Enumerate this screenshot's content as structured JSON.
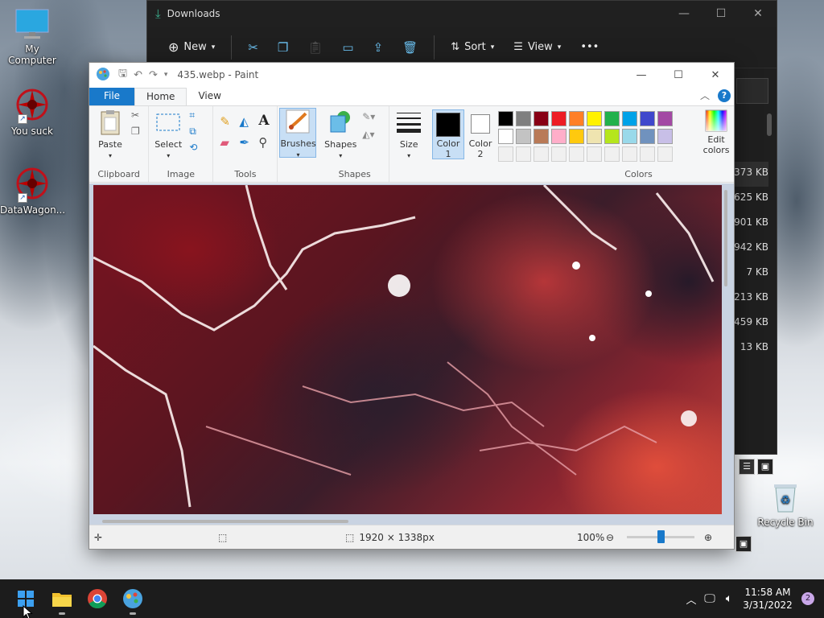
{
  "desktop": {
    "icons": [
      {
        "label": "My Computer",
        "icon": "monitor-icon"
      },
      {
        "label": "You suck",
        "icon": "red-ornament-icon"
      },
      {
        "label": "DataWagon...",
        "icon": "red-ornament-icon"
      },
      {
        "label": "Recycle Bin",
        "icon": "recycle-bin-icon"
      }
    ]
  },
  "explorer": {
    "title": "Downloads",
    "toolbar": {
      "new_label": "New",
      "sort_label": "Sort",
      "view_label": "View",
      "more_label": "•••"
    },
    "file_sizes": [
      "373 KB",
      "625 KB",
      "901 KB",
      "942 KB",
      "7 KB",
      "213 KB",
      "459 KB",
      "13 KB"
    ]
  },
  "paint": {
    "title": "435.webp - Paint",
    "tabs": {
      "file": "File",
      "home": "Home",
      "view": "View"
    },
    "ribbon": {
      "clipboard": {
        "group_label": "Clipboard",
        "paste_label": "Paste"
      },
      "image": {
        "group_label": "Image",
        "select_label": "Select"
      },
      "tools": {
        "group_label": "Tools"
      },
      "brushes_label": "Brushes",
      "shapes": {
        "group_label": "Shapes",
        "shapes_label": "Shapes"
      },
      "size_label": "Size",
      "color1_label": "Color 1",
      "color2_label": "Color 2",
      "colors": {
        "group_label": "Colors",
        "edit_label": "Edit colors",
        "color1": "#000000",
        "color2": "#ffffff",
        "row1": [
          "#000000",
          "#7f7f7f",
          "#880015",
          "#ed1c24",
          "#ff7f27",
          "#fff200",
          "#22b14c",
          "#00a2e8",
          "#3f48cc",
          "#a349a4"
        ],
        "row2": [
          "#ffffff",
          "#c3c3c3",
          "#b97a57",
          "#ffaec9",
          "#ffc90e",
          "#efe4b0",
          "#b5e61d",
          "#99d9ea",
          "#7092be",
          "#c8bfe7"
        ]
      }
    },
    "status": {
      "dimensions": "1920 × 1338px",
      "zoom": "100%"
    }
  },
  "taskbar": {
    "time": "11:58 AM",
    "date": "3/31/2022",
    "notification_count": "2"
  }
}
